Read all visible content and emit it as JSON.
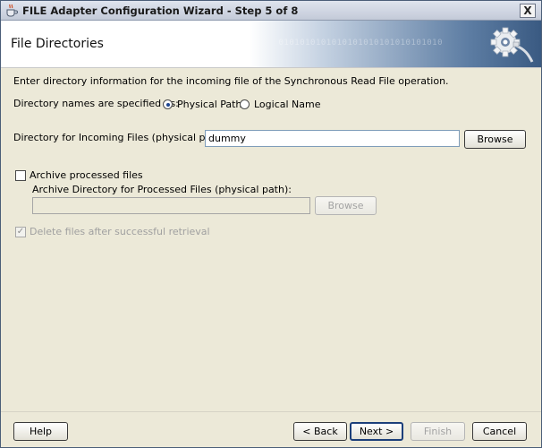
{
  "window": {
    "title": "FILE Adapter Configuration Wizard - Step 5 of 8",
    "close_label": "X"
  },
  "header": {
    "title": "File Directories",
    "banner_binary": "0101010101010101010101010101010"
  },
  "content": {
    "intro": "Enter directory information for the incoming file of the Synchronous Read File operation.",
    "dir_names_label": "Directory names are specified as:",
    "radio_physical": "Physical Path",
    "radio_logical": "Logical Name",
    "selected_option": "Physical Path",
    "incoming_label": "Directory for Incoming Files (physical path):",
    "incoming_value": "dummy",
    "browse_label": "Browse",
    "archive_label": "Archive processed files",
    "archive_dir_label": "Archive Directory for Processed Files (physical path):",
    "archive_dir_value": "",
    "archive_browse_label": "Browse",
    "delete_label": "Delete files after successful retrieval"
  },
  "footer": {
    "help": "Help",
    "back": "< Back",
    "next": "Next >",
    "finish": "Finish",
    "cancel": "Cancel"
  },
  "colors": {
    "title_text": "#1a1a1a",
    "banner_dark": "#3a5a82",
    "dialog_bg": "#ece9d8"
  },
  "icons": [
    "java-cup-icon",
    "close-icon",
    "gear-icon"
  ]
}
